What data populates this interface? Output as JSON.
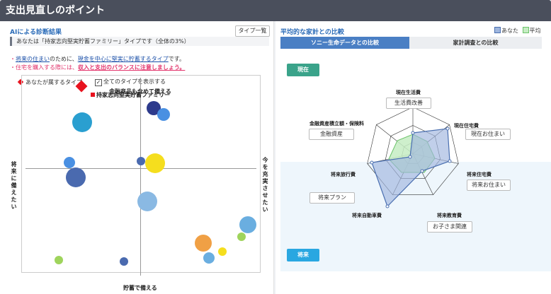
{
  "header": {
    "title": "支出見直しのポイント"
  },
  "left": {
    "title": "AIによる診断結果",
    "type_list_button": "タイプ一覧",
    "result_text": "あなたは「持家志向堅実貯蓄ファミリー」タイプです（全体の3%）",
    "note1": {
      "bullet": "・",
      "link1": "将来の住まい",
      "mid1": "のために、",
      "link2": "現金を中心に堅実に貯蓄するタイプ",
      "tail": "です。"
    },
    "note2": {
      "bullet": "・住宅を購入する際には、",
      "emph": "収入と支出のバランスに注意しましょう。"
    },
    "legend_you": "あなたが属するタイプ",
    "checkbox_label": "全てのタイプを表示する",
    "checkbox_mark": "✓",
    "axis_top": "金融商品も含めて備える",
    "axis_bottom": "貯蓄で備える",
    "axis_left": "将来に備えたい",
    "axis_right": "今を充実させたい",
    "you_label": "持家志向堅実貯蓄ファミリー"
  },
  "right": {
    "title": "平均的な家計との比較",
    "legend_you": "あなた",
    "legend_avg": "平均",
    "tab_sony": "ソニー生命データとの比較",
    "tab_survey": "家計調査との比較",
    "badge_now": "現在",
    "badge_future": "将来",
    "labels": {
      "living": "現在生活費",
      "living_box": "生活費改善",
      "housing_now": "現在住宅費",
      "housing_now_box": "現在お住まい",
      "finance": "金融資産積立額・保険料",
      "finance_box": "金融資産",
      "travel": "将来旅行費",
      "travel_box": "将来プラン",
      "housing_future": "将来住宅費",
      "housing_future_box": "将来お住まい",
      "car": "将来自動車費",
      "edu": "将来教育費",
      "edu_box": "お子さま関連"
    }
  },
  "colors": {
    "you": "#4a6fb0",
    "avg": "#9bd89a",
    "accent": "#2a6bb8"
  }
}
